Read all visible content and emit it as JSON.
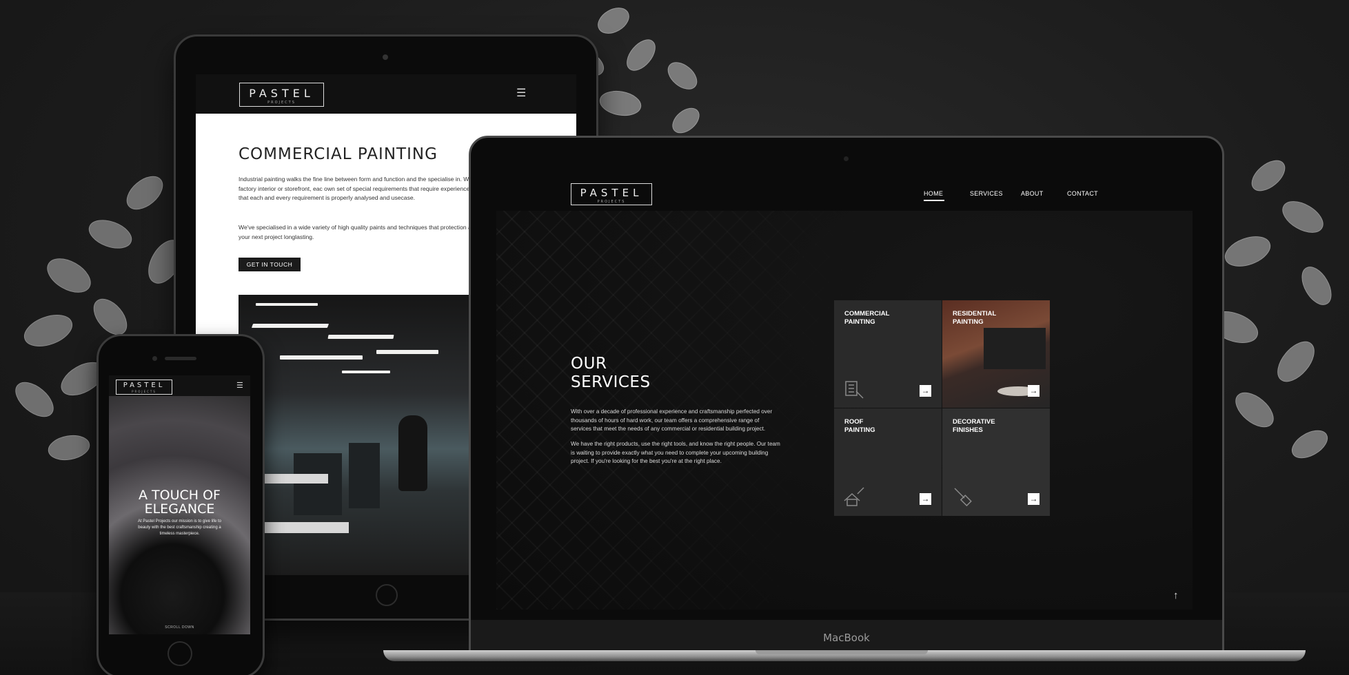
{
  "tablet": {
    "logo": "PASTEL",
    "logo_sub": "PROJECTS",
    "menu_icon": "hamburger-icon",
    "title": "COMMERCIAL PAINTING",
    "paragraph1": "Industrial painting walks the fine line between form and function and the specialise in. Weather it be an office building, factory interior or storefront, eac own set of special requirements that require experience to pull off. Our designed to ensure that each and every requirement is properly analysed and usecase.",
    "paragraph2": "We've specialised in a wide variety of high quality paints and techniques that protection and professional finish to make your next project longlasting.",
    "button": "GET IN TOUCH"
  },
  "phone": {
    "logo": "PASTEL",
    "logo_sub": "PROJECTS",
    "menu_icon": "hamburger-icon",
    "headline": "A TOUCH OF ELEGANCE",
    "text": "At Pastel Projects our mission is to give life to beauty with the best craftsmanship creating a timeless masterpiece.",
    "scroll": "SCROLL DOWN"
  },
  "laptop": {
    "logo": "PASTEL",
    "logo_sub": "PROJECTS",
    "nav": {
      "home": "HOME",
      "services": "SERVICES",
      "about": "ABOUT",
      "contact": "CONTACT"
    },
    "section_title_line1": "OUR",
    "section_title_line2": "SERVICES",
    "paragraph1": "With over a decade of professional experience and craftsmanship perfected over thousands of hours of hard work, our team offers a comprehensive range of services that meet the needs of any commercial or residential building project.",
    "paragraph2": "We have the right products, use the right tools, and know the right people. Our team is waiting to provide exactly what you need to complete your upcoming building project. If you're looking for the best you're at the right place.",
    "tiles": [
      {
        "label": "COMMERCIAL\nPAINTING",
        "icon": "building-icon"
      },
      {
        "label": "RESIDENTIAL\nPAINTING",
        "icon": "arrow-right-icon"
      },
      {
        "label": "ROOF\nPAINTING",
        "icon": "roof-brush-icon"
      },
      {
        "label": "DECORATIVE\nFINISHES",
        "icon": "brush-icon"
      }
    ],
    "scroll_top_icon": "arrow-up-icon",
    "brand": "MacBook"
  },
  "colors": {
    "background": "#1b1b1b",
    "tile_dark": "#2a2a2a",
    "accent_white": "#ffffff"
  }
}
